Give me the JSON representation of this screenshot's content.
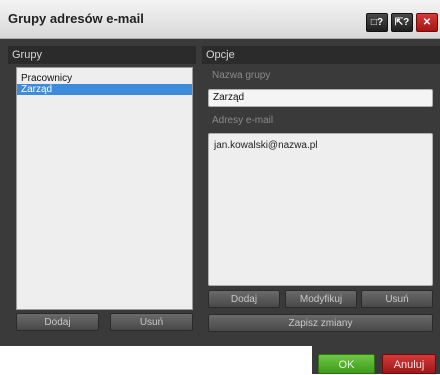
{
  "window": {
    "title": "Grupy adresów e-mail",
    "btn_screenshot": "□?",
    "btn_help": "⇱?",
    "btn_close": "✕"
  },
  "groups_panel": {
    "header": "Grupy",
    "items": [
      {
        "label": "Pracownicy",
        "selected": false
      },
      {
        "label": "Zarząd",
        "selected": true
      }
    ],
    "add_label": "Dodaj",
    "remove_label": "Usuń"
  },
  "options_panel": {
    "header": "Opcje",
    "group_name_label": "Nazwa grupy",
    "group_name_value": "Zarząd",
    "emails_label": "Adresy e-mail",
    "emails": [
      "jan.kowalski@nazwa.pl"
    ],
    "add_label": "Dodaj",
    "modify_label": "Modyfikuj",
    "remove_label": "Usuń",
    "save_label": "Zapisz zmiany"
  },
  "footer": {
    "ok_label": "OK",
    "cancel_label": "Anuluj"
  }
}
